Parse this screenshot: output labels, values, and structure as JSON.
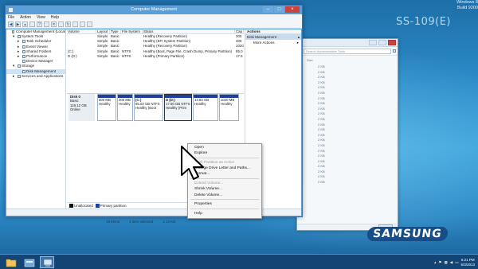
{
  "desktop": {
    "model_label": "SS-109(E)",
    "brand": "SAMSUNG",
    "os_line1": "Windows 8",
    "os_line2": "Build 9200"
  },
  "background_window": {
    "search_placeholder": "Search Administrative Tools",
    "column_size": "Size",
    "sizes": [
      "2 KB",
      "2 KB",
      "2 KB",
      "2 KB",
      "2 KB",
      "2 KB",
      "2 KB",
      "2 KB",
      "2 KB",
      "2 KB",
      "2 KB",
      "2 KB",
      "2 KB",
      "2 KB",
      "2 KB",
      "2 KB",
      "2 KB",
      "2 KB",
      "2 KB",
      "2 KB",
      "2 KB",
      "2 KB",
      "2 KB"
    ],
    "status_count": "18 items",
    "status_selected": "1 item selected",
    "status_size": "1.13 KB"
  },
  "window": {
    "title": "Computer Management",
    "menu": [
      "File",
      "Action",
      "View",
      "Help"
    ],
    "toolbar_icons": [
      "back-icon",
      "forward-icon",
      "up-icon",
      "properties-icon",
      "help-icon",
      "console-icon",
      "delete-icon",
      "properties-icon",
      "refresh-icon",
      "explore-icon",
      "folder-icon",
      "console-icon"
    ]
  },
  "tree": [
    {
      "label": "Computer Management (Local",
      "indent": 0,
      "icon": "computer-icon",
      "toggle": ""
    },
    {
      "label": "System Tools",
      "indent": 1,
      "icon": "tools-icon",
      "toggle": "▾"
    },
    {
      "label": "Task Scheduler",
      "indent": 2,
      "icon": "clock-icon",
      "toggle": "▸"
    },
    {
      "label": "Event Viewer",
      "indent": 2,
      "icon": "event-icon",
      "toggle": "▸"
    },
    {
      "label": "Shared Folders",
      "indent": 2,
      "icon": "folder-icon",
      "toggle": "▸"
    },
    {
      "label": "Performance",
      "indent": 2,
      "icon": "chart-icon",
      "toggle": "▸"
    },
    {
      "label": "Device Manager",
      "indent": 2,
      "icon": "device-icon",
      "toggle": ""
    },
    {
      "label": "Storage",
      "indent": 1,
      "icon": "storage-icon",
      "toggle": "▾"
    },
    {
      "label": "Disk Management",
      "indent": 2,
      "icon": "disk-icon",
      "toggle": "",
      "selected": true
    },
    {
      "label": "Services and Applications",
      "indent": 1,
      "icon": "services-icon",
      "toggle": "▸"
    }
  ],
  "volumes": {
    "headers": [
      "Volume",
      "Layout",
      "Type",
      "File System",
      "Status",
      "Cap"
    ],
    "rows": [
      [
        "",
        "Simple",
        "Basic",
        "",
        "Healthy (Recovery Partition)",
        "300"
      ],
      [
        "",
        "Simple",
        "Basic",
        "",
        "Healthy (EFI System Partition)",
        "300"
      ],
      [
        "",
        "Simple",
        "Basic",
        "",
        "Healthy (Recovery Partition)",
        "1020"
      ],
      [
        "(C:)",
        "Simple",
        "Basic",
        "NTFS",
        "Healthy (Boot, Page File, Crash Dump, Primary Partition)",
        "85.0"
      ],
      [
        "D (D:)",
        "Simple",
        "Basic",
        "NTFS",
        "Healthy (Primary Partition)",
        "17.5"
      ]
    ]
  },
  "disk": {
    "name": "Disk 0",
    "type": "Basic",
    "size": "119.12 GB",
    "status": "Online",
    "partitions": [
      {
        "title": "",
        "size": "500 MB",
        "status": "Healthy"
      },
      {
        "title": "",
        "size": "300 MB",
        "status": "Healthy"
      },
      {
        "title": "(C:)",
        "size": "85.03 GB NTFS",
        "status": "Healthy (Boot"
      },
      {
        "title": "D (D:)",
        "size": "17.50 GB NTFS",
        "status": "Healthy (Prim"
      },
      {
        "title": "",
        "size": "13.83 GB",
        "status": "Healthy"
      },
      {
        "title": "",
        "size": "1020 MB",
        "status": "Healthy"
      }
    ]
  },
  "legend": [
    {
      "label": "Unallocated",
      "color": "#111111"
    },
    {
      "label": "Primary partition",
      "color": "#1f3f9a"
    }
  ],
  "actions": {
    "header": "Actions",
    "selected": "Disk Management",
    "items": [
      "More Actions"
    ]
  },
  "context_menu": {
    "items": [
      {
        "label": "Open",
        "disabled": false
      },
      {
        "label": "Explore",
        "disabled": false
      },
      {
        "sep": true
      },
      {
        "label": "Mark Partition as Active",
        "disabled": true
      },
      {
        "label": "Change Drive Letter and Paths...",
        "disabled": false
      },
      {
        "label": "Format...",
        "disabled": false
      },
      {
        "sep": true
      },
      {
        "label": "Extend Volume...",
        "disabled": true
      },
      {
        "label": "Shrink Volume...",
        "disabled": false
      },
      {
        "label": "Delete Volume...",
        "disabled": false
      },
      {
        "sep": true
      },
      {
        "label": "Properties",
        "disabled": false
      },
      {
        "sep": true
      },
      {
        "label": "Help",
        "disabled": false
      }
    ]
  },
  "taskbar": {
    "apps": [
      "explorer-icon",
      "server-manager-icon",
      "computer-management-icon"
    ],
    "time": "6:21 PM",
    "date": "5/3/2013"
  }
}
